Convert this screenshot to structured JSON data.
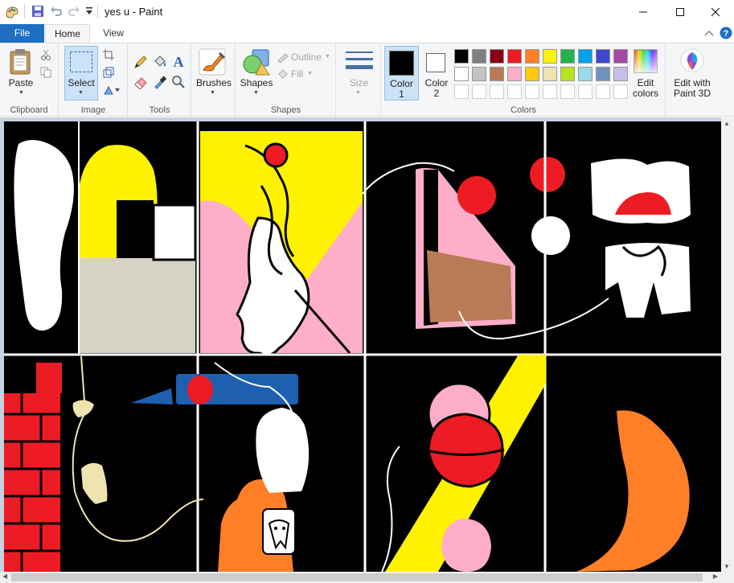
{
  "window": {
    "title": "yes u - Paint",
    "controls": {
      "minimize": "minimize",
      "maximize": "maximize",
      "close": "close"
    }
  },
  "tabs": [
    {
      "label": "File"
    },
    {
      "label": "Home"
    },
    {
      "label": "View"
    }
  ],
  "ribbon": {
    "clipboard": {
      "group_label": "Clipboard",
      "paste_label": "Paste"
    },
    "image": {
      "group_label": "Image",
      "select_label": "Select"
    },
    "tools": {
      "group_label": "Tools"
    },
    "brushes": {
      "label": "Brushes"
    },
    "shapes": {
      "group_label": "Shapes",
      "shapes_label": "Shapes",
      "outline_label": "Outline",
      "fill_label": "Fill"
    },
    "size": {
      "label": "Size"
    },
    "colors": {
      "group_label": "Colors",
      "color1_label_a": "Color",
      "color1_label_b": "1",
      "color2_label_a": "Color",
      "color2_label_b": "2",
      "color1_value": "#000000",
      "color2_value": "#ffffff",
      "edit_colors_a": "Edit",
      "edit_colors_b": "colors",
      "palette_row1": [
        "#000000",
        "#7f7f7f",
        "#880015",
        "#ed1c24",
        "#ff7f27",
        "#fff200",
        "#22b14c",
        "#00a2e8",
        "#3f48cc",
        "#a349a4"
      ],
      "palette_row2": [
        "#ffffff",
        "#c3c3c3",
        "#b97a57",
        "#ffaec9",
        "#ffc90e",
        "#efe4b0",
        "#b5e61d",
        "#99d9ea",
        "#7092be",
        "#c8bfe7"
      ]
    },
    "paint3d": {
      "label_a": "Edit with",
      "label_b": "Paint 3D"
    }
  }
}
